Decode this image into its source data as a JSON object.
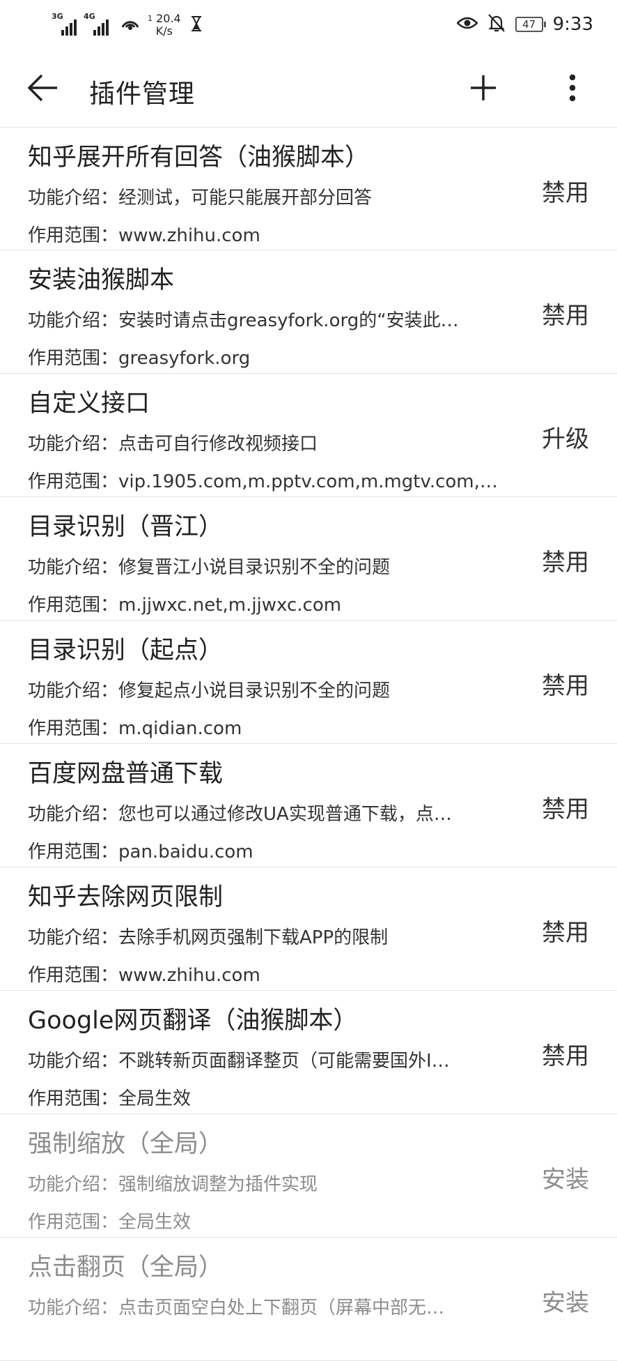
{
  "status_bar": {
    "signal1_label": "3G",
    "signal2_label": "4G",
    "hotspot_count": "1",
    "speed_value": "20.4",
    "speed_unit": "K/s",
    "battery": "47",
    "time": "9:33"
  },
  "toolbar": {
    "title": "插件管理"
  },
  "labels": {
    "desc_prefix": "功能介绍：",
    "scope_prefix": "作用范围："
  },
  "plugins": [
    {
      "name": "知乎展开所有回答（油猴脚本）",
      "desc": "经测试，可能只能展开部分回答",
      "scope": "www.zhihu.com",
      "action": "禁用"
    },
    {
      "name": "安装油猴脚本",
      "desc": "安装时请点击greasyfork.org的“安装此…",
      "scope": "greasyfork.org",
      "action": "禁用"
    },
    {
      "name": "自定义接口",
      "desc": "点击可自行修改视频接口",
      "scope": "vip.1905.com,m.pptv.com,m.mgtv.com,…",
      "action": "升级"
    },
    {
      "name": "目录识别（晋江）",
      "desc": "修复晋江小说目录识别不全的问题",
      "scope": "m.jjwxc.net,m.jjwxc.com",
      "action": "禁用"
    },
    {
      "name": "目录识别（起点）",
      "desc": "修复起点小说目录识别不全的问题",
      "scope": "m.qidian.com",
      "action": "禁用"
    },
    {
      "name": "百度网盘普通下载",
      "desc": "您也可以通过修改UA实现普通下载，点…",
      "scope": "pan.baidu.com",
      "action": "禁用"
    },
    {
      "name": "知乎去除网页限制",
      "desc": "去除手机网页强制下载APP的限制",
      "scope": "www.zhihu.com",
      "action": "禁用"
    },
    {
      "name": "Google网页翻译（油猴脚本）",
      "desc": "不跳转新页面翻译整页（可能需要国外I…",
      "scope": "全局生效",
      "action": "禁用"
    },
    {
      "name": "强制缩放（全局）",
      "desc": "强制缩放调整为插件实现",
      "scope": "全局生效",
      "action": "安装"
    },
    {
      "name": "点击翻页（全局）",
      "desc": "点击页面空白处上下翻页（屏幕中部无…",
      "scope": "",
      "action": "安装"
    }
  ]
}
